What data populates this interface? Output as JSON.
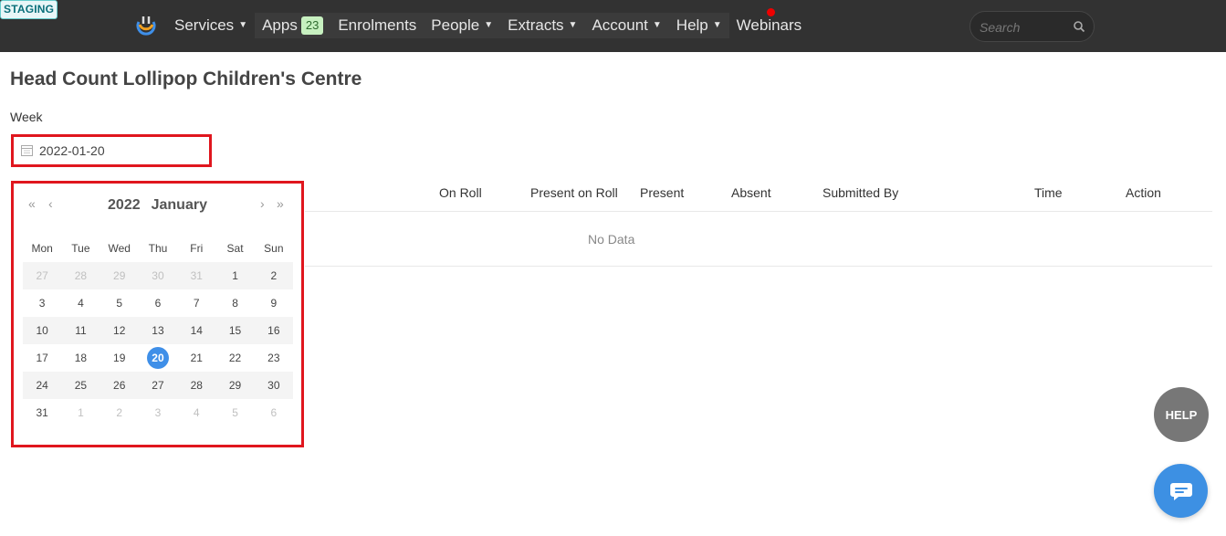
{
  "env_badge": "STAGING",
  "nav": {
    "items": [
      {
        "label": "Services",
        "caret": true
      },
      {
        "label": "Apps",
        "badge": "23"
      },
      {
        "label": "Enrolments"
      },
      {
        "label": "People",
        "caret": true
      },
      {
        "label": "Extracts",
        "caret": true
      },
      {
        "label": "Account",
        "caret": true
      },
      {
        "label": "Help",
        "caret": true
      },
      {
        "label": "Webinars"
      }
    ],
    "search_placeholder": "Search"
  },
  "page": {
    "title": "Head Count Lollipop Children's Centre",
    "week_label": "Week",
    "week_value": "2022-01-20"
  },
  "table": {
    "columns": [
      "On Roll",
      "Present on Roll",
      "Present",
      "Absent",
      "Submitted By",
      "Time",
      "Action"
    ],
    "empty_text": "No Data"
  },
  "calendar": {
    "year": "2022",
    "month": "January",
    "prev_year": "«",
    "prev_month": "‹",
    "next_month": "›",
    "next_year": "»",
    "weekdays": [
      "Mon",
      "Tue",
      "Wed",
      "Thu",
      "Fri",
      "Sat",
      "Sun"
    ],
    "weeks": [
      [
        "27",
        "28",
        "29",
        "30",
        "31",
        "1",
        "2"
      ],
      [
        "3",
        "4",
        "5",
        "6",
        "7",
        "8",
        "9"
      ],
      [
        "10",
        "11",
        "12",
        "13",
        "14",
        "15",
        "16"
      ],
      [
        "17",
        "18",
        "19",
        "20",
        "21",
        "22",
        "23"
      ],
      [
        "24",
        "25",
        "26",
        "27",
        "28",
        "29",
        "30"
      ],
      [
        "31",
        "1",
        "2",
        "3",
        "4",
        "5",
        "6"
      ]
    ],
    "selected": "20"
  },
  "floating": {
    "help_label": "HELP",
    "chat_icon": "chat-icon"
  },
  "colors": {
    "topbar": "#323232",
    "accent": "#3f8fe8",
    "highlight": "#e0161e",
    "notification": "#e00000"
  }
}
